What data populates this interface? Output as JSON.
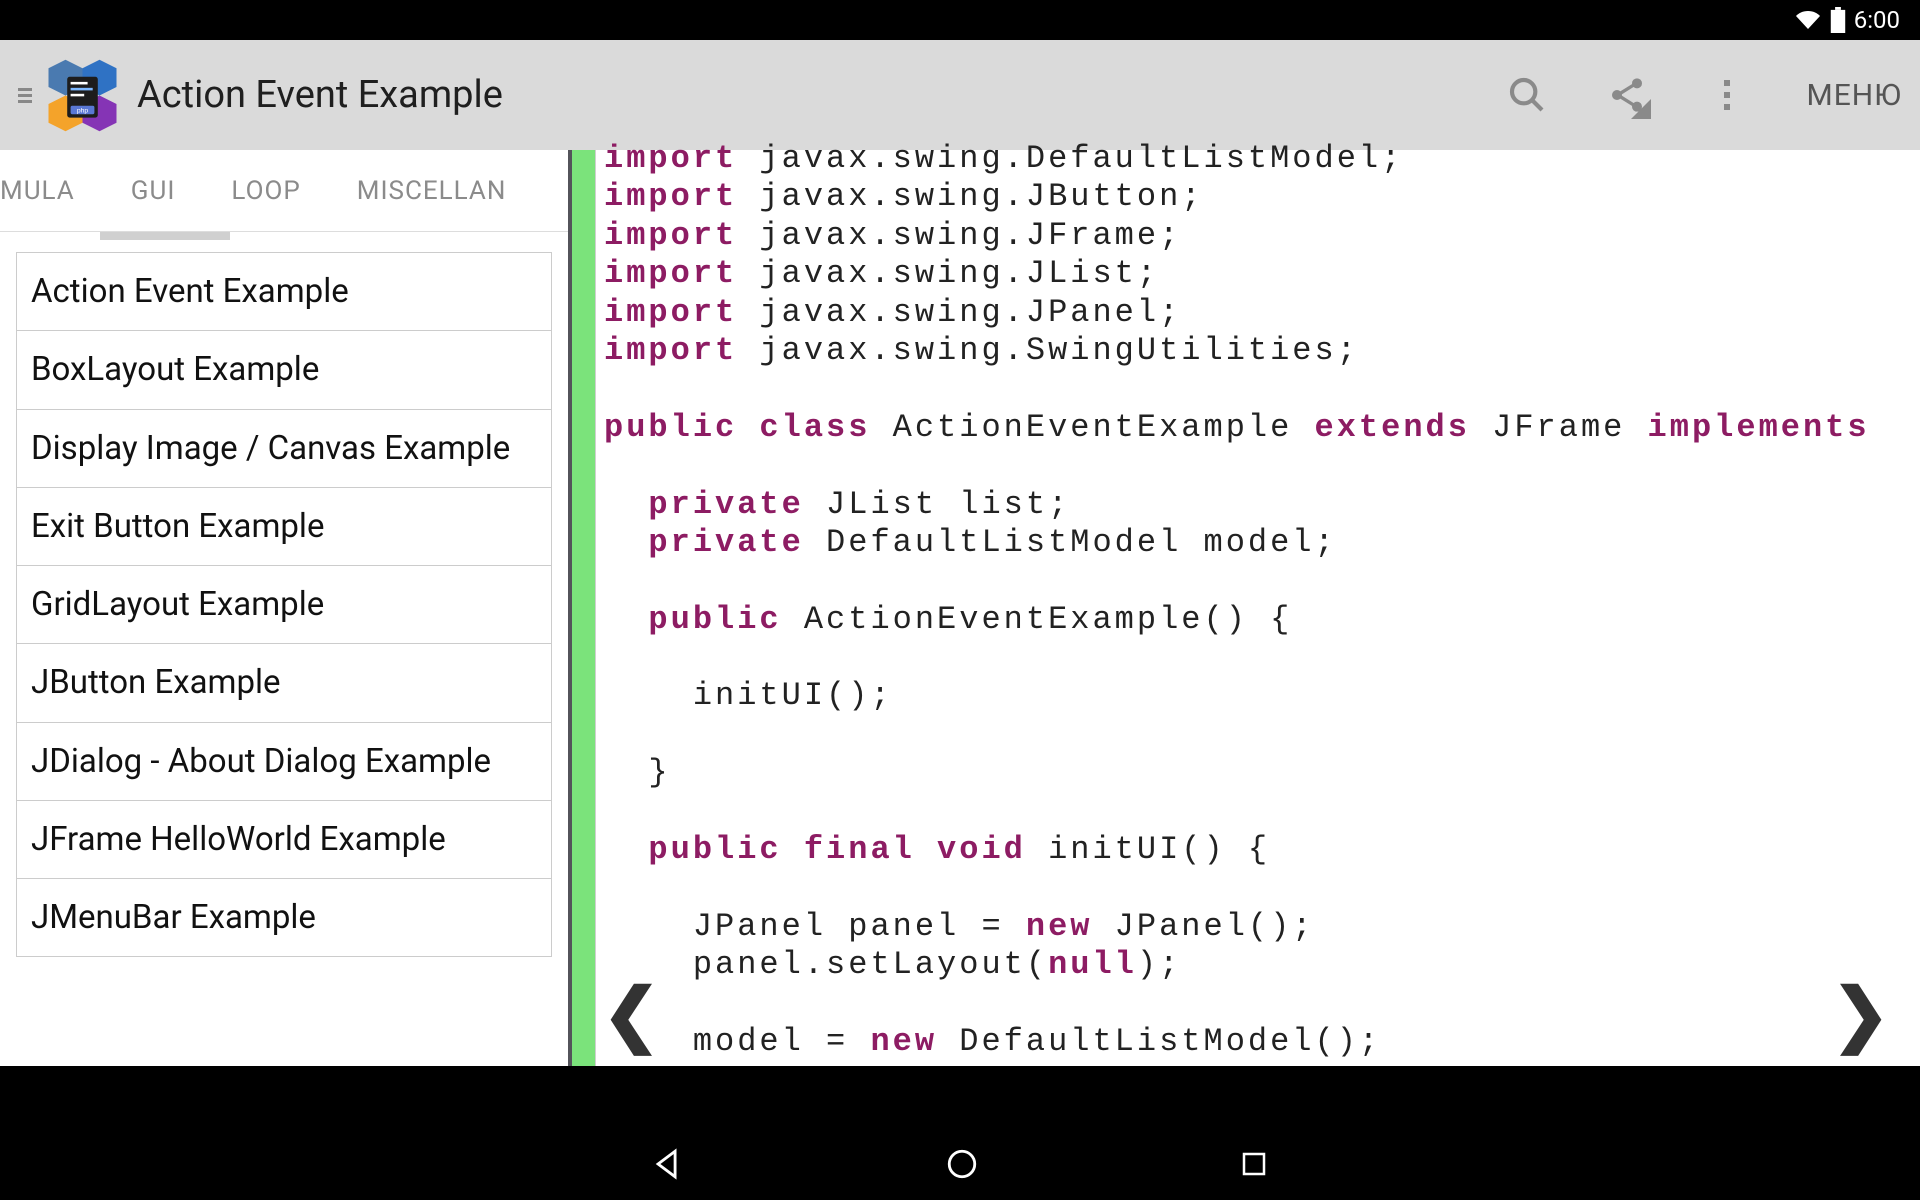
{
  "status": {
    "time": "6:00"
  },
  "header": {
    "title": "Action Event Example",
    "menu_label": "МЕНЮ"
  },
  "sidebar": {
    "tabs": [
      "MULA",
      "GUI",
      "LOOP",
      "MISCELLAN"
    ],
    "active_tab_index": 1,
    "items": [
      "Action Event Example",
      "BoxLayout Example",
      "Display Image / Canvas Example",
      "Exit Button Example",
      "GridLayout Example",
      "JButton Example",
      "JDialog - About Dialog Example",
      "JFrame HelloWorld Example",
      "JMenuBar Example"
    ]
  },
  "code": {
    "lines": [
      {
        "t": [
          {
            "k": 1,
            "s": "import"
          },
          {
            "k": 0,
            "s": " javax.swing.DefaultListModel;"
          }
        ]
      },
      {
        "t": [
          {
            "k": 1,
            "s": "import"
          },
          {
            "k": 0,
            "s": " javax.swing.JButton;"
          }
        ]
      },
      {
        "t": [
          {
            "k": 1,
            "s": "import"
          },
          {
            "k": 0,
            "s": " javax.swing.JFrame;"
          }
        ]
      },
      {
        "t": [
          {
            "k": 1,
            "s": "import"
          },
          {
            "k": 0,
            "s": " javax.swing.JList;"
          }
        ]
      },
      {
        "t": [
          {
            "k": 1,
            "s": "import"
          },
          {
            "k": 0,
            "s": " javax.swing.JPanel;"
          }
        ]
      },
      {
        "t": [
          {
            "k": 1,
            "s": "import"
          },
          {
            "k": 0,
            "s": " javax.swing.SwingUtilities;"
          }
        ]
      },
      {
        "t": [
          {
            "k": 0,
            "s": ""
          }
        ]
      },
      {
        "t": [
          {
            "k": 1,
            "s": "public class"
          },
          {
            "k": 0,
            "s": " ActionEventExample "
          },
          {
            "k": 1,
            "s": "extends"
          },
          {
            "k": 0,
            "s": " JFrame "
          },
          {
            "k": 1,
            "s": "implements"
          }
        ]
      },
      {
        "t": [
          {
            "k": 0,
            "s": ""
          }
        ]
      },
      {
        "t": [
          {
            "k": 0,
            "s": "  "
          },
          {
            "k": 1,
            "s": "private"
          },
          {
            "k": 0,
            "s": " JList list;"
          }
        ]
      },
      {
        "t": [
          {
            "k": 0,
            "s": "  "
          },
          {
            "k": 1,
            "s": "private"
          },
          {
            "k": 0,
            "s": " DefaultListModel model;"
          }
        ]
      },
      {
        "t": [
          {
            "k": 0,
            "s": ""
          }
        ]
      },
      {
        "t": [
          {
            "k": 0,
            "s": "  "
          },
          {
            "k": 1,
            "s": "public"
          },
          {
            "k": 0,
            "s": " ActionEventExample() {"
          }
        ]
      },
      {
        "t": [
          {
            "k": 0,
            "s": ""
          }
        ]
      },
      {
        "t": [
          {
            "k": 0,
            "s": "    initUI();"
          }
        ]
      },
      {
        "t": [
          {
            "k": 0,
            "s": ""
          }
        ]
      },
      {
        "t": [
          {
            "k": 0,
            "s": "  }"
          }
        ]
      },
      {
        "t": [
          {
            "k": 0,
            "s": ""
          }
        ]
      },
      {
        "t": [
          {
            "k": 0,
            "s": "  "
          },
          {
            "k": 1,
            "s": "public final void"
          },
          {
            "k": 0,
            "s": " initUI() {"
          }
        ]
      },
      {
        "t": [
          {
            "k": 0,
            "s": ""
          }
        ]
      },
      {
        "t": [
          {
            "k": 0,
            "s": "    JPanel panel = "
          },
          {
            "k": 1,
            "s": "new"
          },
          {
            "k": 0,
            "s": " JPanel();"
          }
        ]
      },
      {
        "t": [
          {
            "k": 0,
            "s": "    panel.setLayout("
          },
          {
            "k": 2,
            "s": "null"
          },
          {
            "k": 0,
            "s": ");"
          }
        ]
      },
      {
        "t": [
          {
            "k": 0,
            "s": ""
          }
        ]
      },
      {
        "t": [
          {
            "k": 0,
            "s": "    model = "
          },
          {
            "k": 1,
            "s": "new"
          },
          {
            "k": 0,
            "s": " DefaultListModel();"
          }
        ]
      }
    ]
  }
}
